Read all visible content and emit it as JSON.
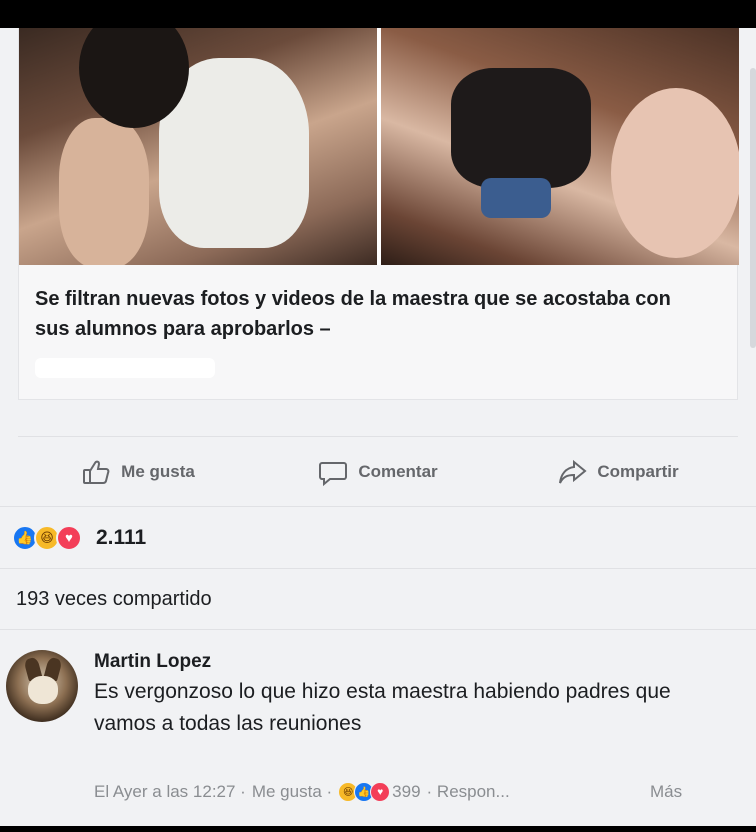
{
  "link_card": {
    "title": "Se filtran nuevas fotos y videos de la maestra que se acostaba con sus alumnos para aprobarlos –"
  },
  "actions": {
    "like": "Me gusta",
    "comment": "Comentar",
    "share": "Compartir"
  },
  "reactions": {
    "count": "2.111"
  },
  "shares": {
    "text": "193 veces compartido"
  },
  "comment": {
    "author": "Martin Lopez",
    "text": "Es vergonzoso lo que hizo esta maestra habiendo padres que vamos a todas las reuniones",
    "meta_time": "El Ayer a las 12:27 ·",
    "meta_like": "Me gusta ·",
    "meta_count": "399",
    "meta_reply": "· Respon...",
    "meta_more": "Más"
  },
  "colors": {
    "accent": "#1877f2",
    "haha": "#f7b928",
    "love": "#f33e58"
  }
}
